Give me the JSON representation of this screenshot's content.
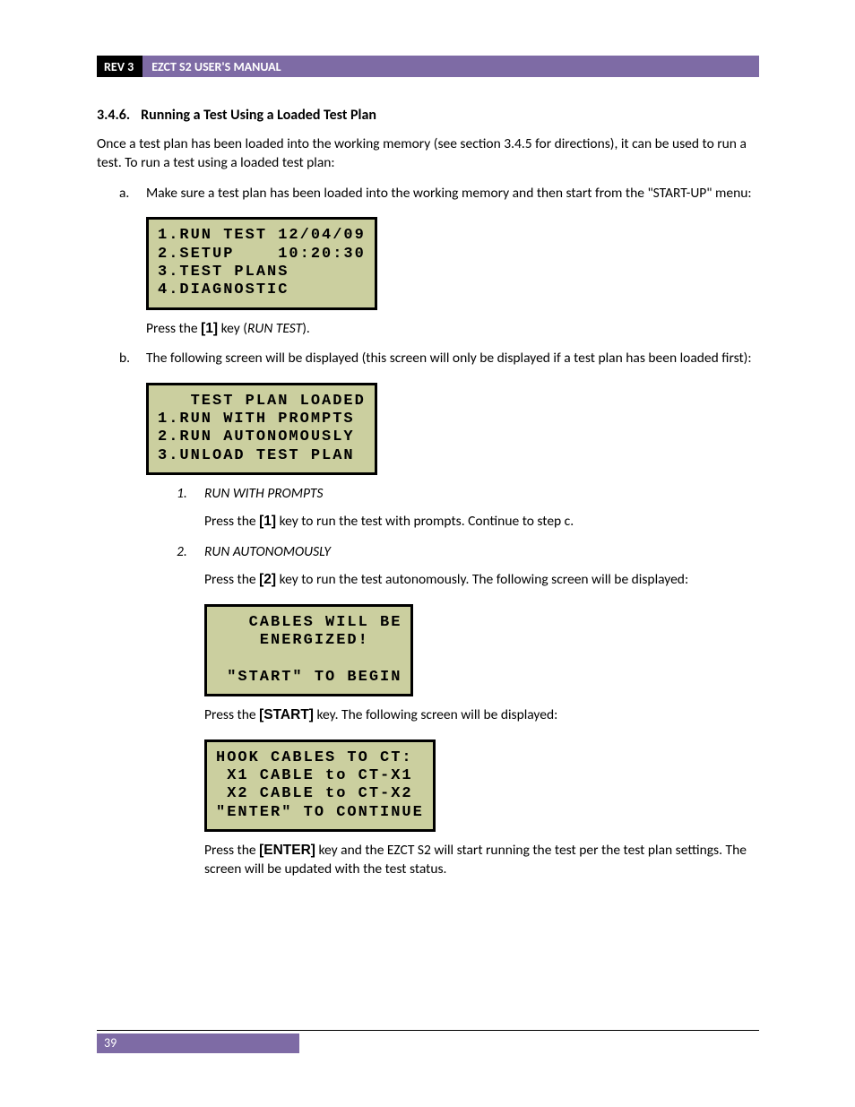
{
  "header": {
    "rev": "REV 3",
    "title": "EZCT S2 USER'S MANUAL"
  },
  "section": {
    "number": "3.4.6.",
    "title": "Running a Test Using a Loaded Test Plan",
    "intro": "Once a test plan has been loaded into the working memory (see section 3.4.5 for directions), it can be used to run a test. To run a test using a loaded test plan:"
  },
  "step_a": {
    "marker": "a.",
    "text": "Make sure a test plan has been loaded into the working memory and then start from the \"START-UP\" menu:",
    "lcd": "1.RUN TEST 12/04/09\n2.SETUP    10:20:30\n3.TEST PLANS\n4.DIAGNOSTIC",
    "after_pre": "Press the ",
    "key": "[1]",
    "after_mid": " key (",
    "ital": "RUN TEST",
    "after_post": ")."
  },
  "step_b": {
    "marker": "b.",
    "text": "The following screen will be displayed (this screen will only be displayed if a test plan has been loaded first):",
    "lcd": "   TEST PLAN LOADED\n1.RUN WITH PROMPTS\n2.RUN AUTONOMOUSLY\n3.UNLOAD TEST PLAN"
  },
  "opt1": {
    "marker": "1.",
    "title": "RUN WITH PROMPTS",
    "line_pre": "Press the ",
    "key": "[1]",
    "line_post": " key to run the test with prompts. Continue to step c."
  },
  "opt2": {
    "marker": "2.",
    "title": "RUN AUTONOMOUSLY",
    "line_pre": "Press the ",
    "key": "[2]",
    "line_post": " key to run the test autonomously. The following screen will be displayed:",
    "lcd1": "   CABLES WILL BE\n    ENERGIZED!\n\n \"START\" TO BEGIN",
    "after1_pre": "Press the ",
    "after1_key": "[START]",
    "after1_post": " key. The following screen will be displayed:",
    "lcd2": "HOOK CABLES TO CT:\n X1 CABLE to CT-X1\n X2 CABLE to CT-X2\n\"ENTER\" TO CONTINUE",
    "after2_pre": "Press the ",
    "after2_key": "[ENTER]",
    "after2_post": " key and the EZCT S2 will start running the test per the test plan settings. The screen will be updated with the test status."
  },
  "page_number": "39"
}
